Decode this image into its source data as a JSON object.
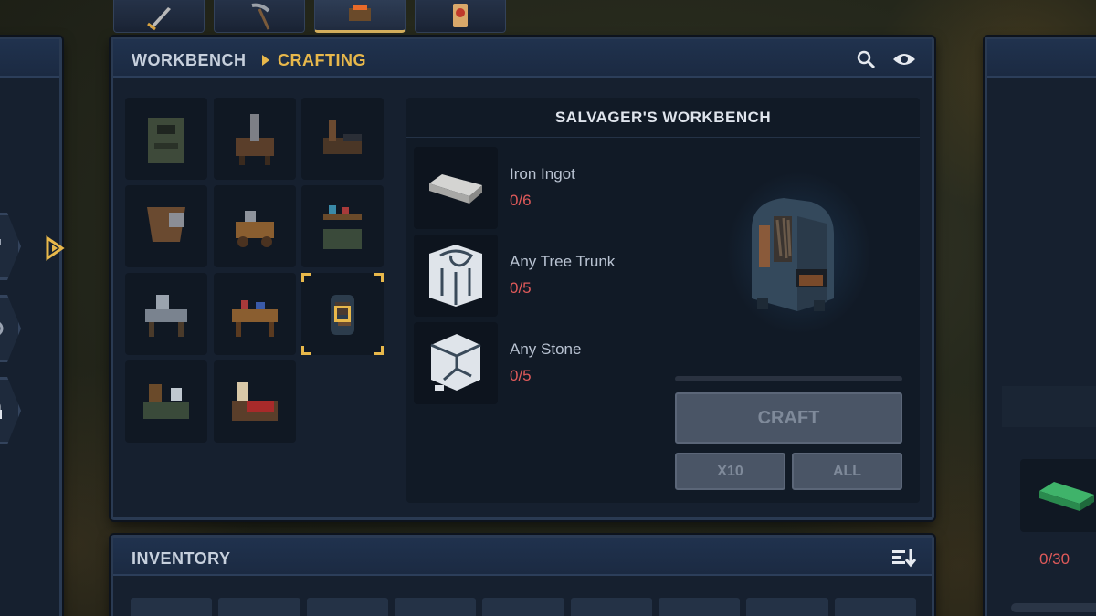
{
  "tool_tabs": [
    {
      "icon": "sword-icon"
    },
    {
      "icon": "pickaxe-icon"
    },
    {
      "icon": "workbench-icon",
      "active": true
    },
    {
      "icon": "scroll-icon"
    }
  ],
  "crafting_panel": {
    "breadcrumb_root": "WORKBENCH",
    "breadcrumb_current": "CRAFTING",
    "search_icon": "search-icon",
    "view_icon": "eye-icon",
    "grid_items": [
      {
        "icon": "stone-furnace-icon"
      },
      {
        "icon": "tool-rack-icon"
      },
      {
        "icon": "anvil-station-icon"
      },
      {
        "icon": "tanning-rack-icon"
      },
      {
        "icon": "cart-workbench-icon"
      },
      {
        "icon": "alchemy-shelf-icon"
      },
      {
        "icon": "carpentry-table-icon"
      },
      {
        "icon": "tinker-bench-icon"
      },
      {
        "icon": "salvager-workbench-icon",
        "selected": true
      },
      {
        "icon": "herbal-station-icon"
      },
      {
        "icon": "loom-table-icon"
      }
    ],
    "recipe": {
      "title": "SALVAGER'S WORKBENCH",
      "ingredients": [
        {
          "name": "Iron Ingot",
          "count": "0/6",
          "icon": "iron-ingot-icon"
        },
        {
          "name": "Any Tree Trunk",
          "count": "0/5",
          "icon": "tree-trunk-icon"
        },
        {
          "name": "Any Stone",
          "count": "0/5",
          "icon": "stone-icon"
        }
      ],
      "preview_icon": "salvager-workbench-preview",
      "progress": 0,
      "craft_label": "CRAFT",
      "x10_label": "X10",
      "all_label": "ALL"
    }
  },
  "inventory_panel": {
    "title": "INVENTORY",
    "sort_icon": "sort-icon",
    "slot_count": 9
  },
  "right_panel": {
    "item_icon": "green-ingot-icon",
    "item_count": "0/30"
  },
  "colors": {
    "accent": "#e8b84b",
    "header_text": "#d6dbe4",
    "missing": "#e05a5a",
    "panel_bg": "#16202f"
  }
}
